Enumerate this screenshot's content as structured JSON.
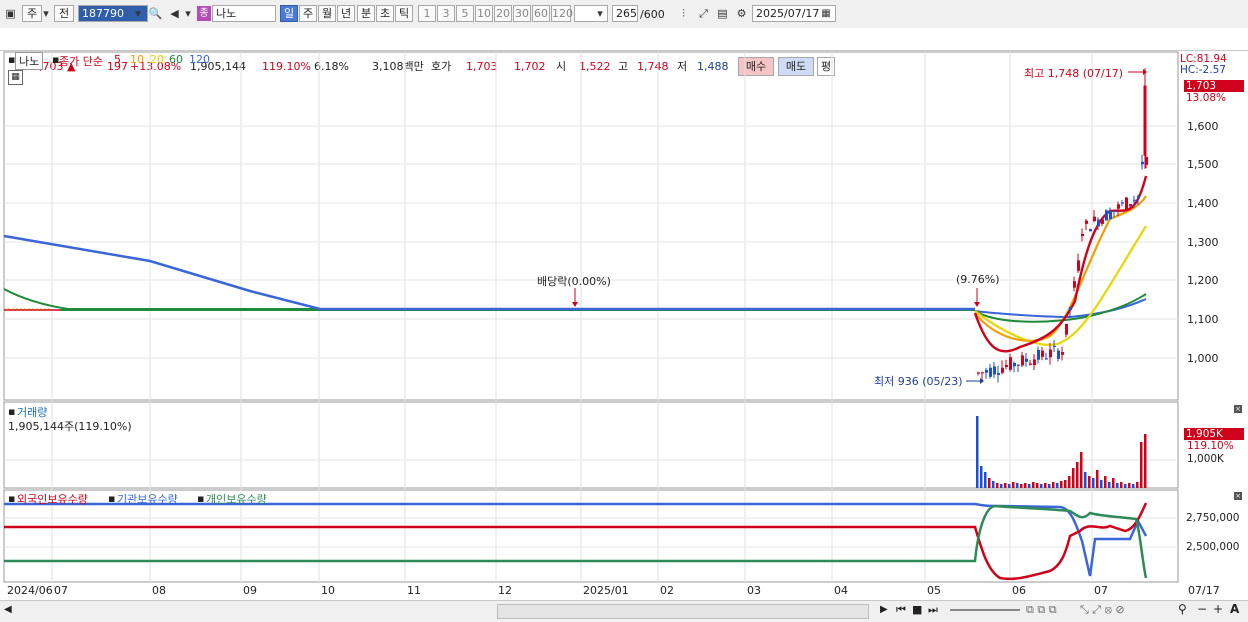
{
  "toolbar": {
    "stock_code": "187790",
    "stock_name": "나노",
    "label_ju": "주",
    "label_jeon": "전",
    "badge_jong": "종",
    "periods": [
      "일",
      "주",
      "월",
      "년",
      "분",
      "초",
      "틱"
    ],
    "minutes": [
      "1",
      "3",
      "5",
      "10",
      "20",
      "30",
      "60",
      "120"
    ],
    "count_value": "265",
    "count_total": "/600",
    "date": "2025/07/17"
  },
  "quote": {
    "price": "1,703",
    "change": "197",
    "change_pct": "+13.08%",
    "volume": "1,905,144",
    "volume_ratio": "119.10%",
    "turnover": "6.18%",
    "trade_value": "3,108백만",
    "hoga_label": "호가",
    "ask": "1,703",
    "bid": "1,702",
    "open_label": "시",
    "open": "1,522",
    "high_label": "고",
    "high": "1,748",
    "low_label": "저",
    "low": "1,488",
    "buy_label": "매수",
    "sell_label": "매도",
    "avg_label": "평"
  },
  "price_panel": {
    "name_tag": "나노",
    "ma_title": "종가 단순",
    "ma_periods": [
      "5",
      "10",
      "20",
      "60",
      "120"
    ],
    "ma_colors": [
      "#d0021b",
      "#f0a000",
      "#e6d800",
      "#1f8a3a",
      "#3a66d8"
    ],
    "lc": "LC:81.94",
    "hc": "HC:-2.57",
    "last_price": "1,703",
    "last_pct": "13.08%",
    "y_ticks": [
      "1,600",
      "1,500",
      "1,400",
      "1,300",
      "1,200",
      "1,100",
      "1,000"
    ],
    "annotations": {
      "high": "최고 1,748 (07/17)",
      "low": "최저 936 (05/23)",
      "dividend": "배당락(0.00%)",
      "event": "(9.76%)"
    }
  },
  "volume_panel": {
    "title": "거래량",
    "value": "1,905,144주(119.10%)",
    "last": "1,905K",
    "last_pct": "119.10%",
    "tick": "1,000K"
  },
  "holding_panel": {
    "legend": [
      "외국인보유수량",
      "기관보유수량",
      "개인보유수량"
    ],
    "legend_colors": [
      "#d0021b",
      "#3a66d8",
      "#2e8b57"
    ],
    "ticks": [
      "2,750,000",
      "2,500,000"
    ]
  },
  "x_axis": {
    "labels": [
      "2024/06",
      "07",
      "08",
      "09",
      "10",
      "11",
      "12",
      "2025/01",
      "02",
      "03",
      "04",
      "05",
      "06",
      "07"
    ],
    "end_label": "07/17"
  },
  "chart_data": {
    "type": "line",
    "title": "",
    "ylim": [
      900,
      1760
    ],
    "series": [
      {
        "name": "5",
        "color": "#d0021b"
      },
      {
        "name": "10",
        "color": "#f0a000"
      },
      {
        "name": "20",
        "color": "#e6d800"
      },
      {
        "name": "60",
        "color": "#1f8a3a"
      },
      {
        "name": "120",
        "color": "#3a66d8"
      }
    ],
    "high": 1748,
    "low": 936,
    "last": 1703
  }
}
